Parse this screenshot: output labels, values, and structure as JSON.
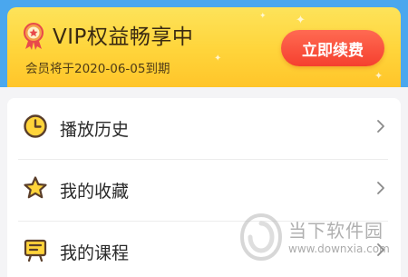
{
  "vip": {
    "title": "VIP权益畅享中",
    "expiry_text": "会员将于2020-06-05到期",
    "renew_label": "立即续费",
    "colors": {
      "card": "#ffd43a",
      "button": "#f5402f",
      "strip": "#4aa7ee"
    }
  },
  "menu": {
    "items": [
      {
        "label": "播放历史",
        "icon": "clock-icon"
      },
      {
        "label": "我的收藏",
        "icon": "star-icon"
      },
      {
        "label": "我的课程",
        "icon": "course-icon"
      }
    ]
  },
  "watermark": {
    "title": "当下软件园",
    "url": "www.downxia.com"
  }
}
